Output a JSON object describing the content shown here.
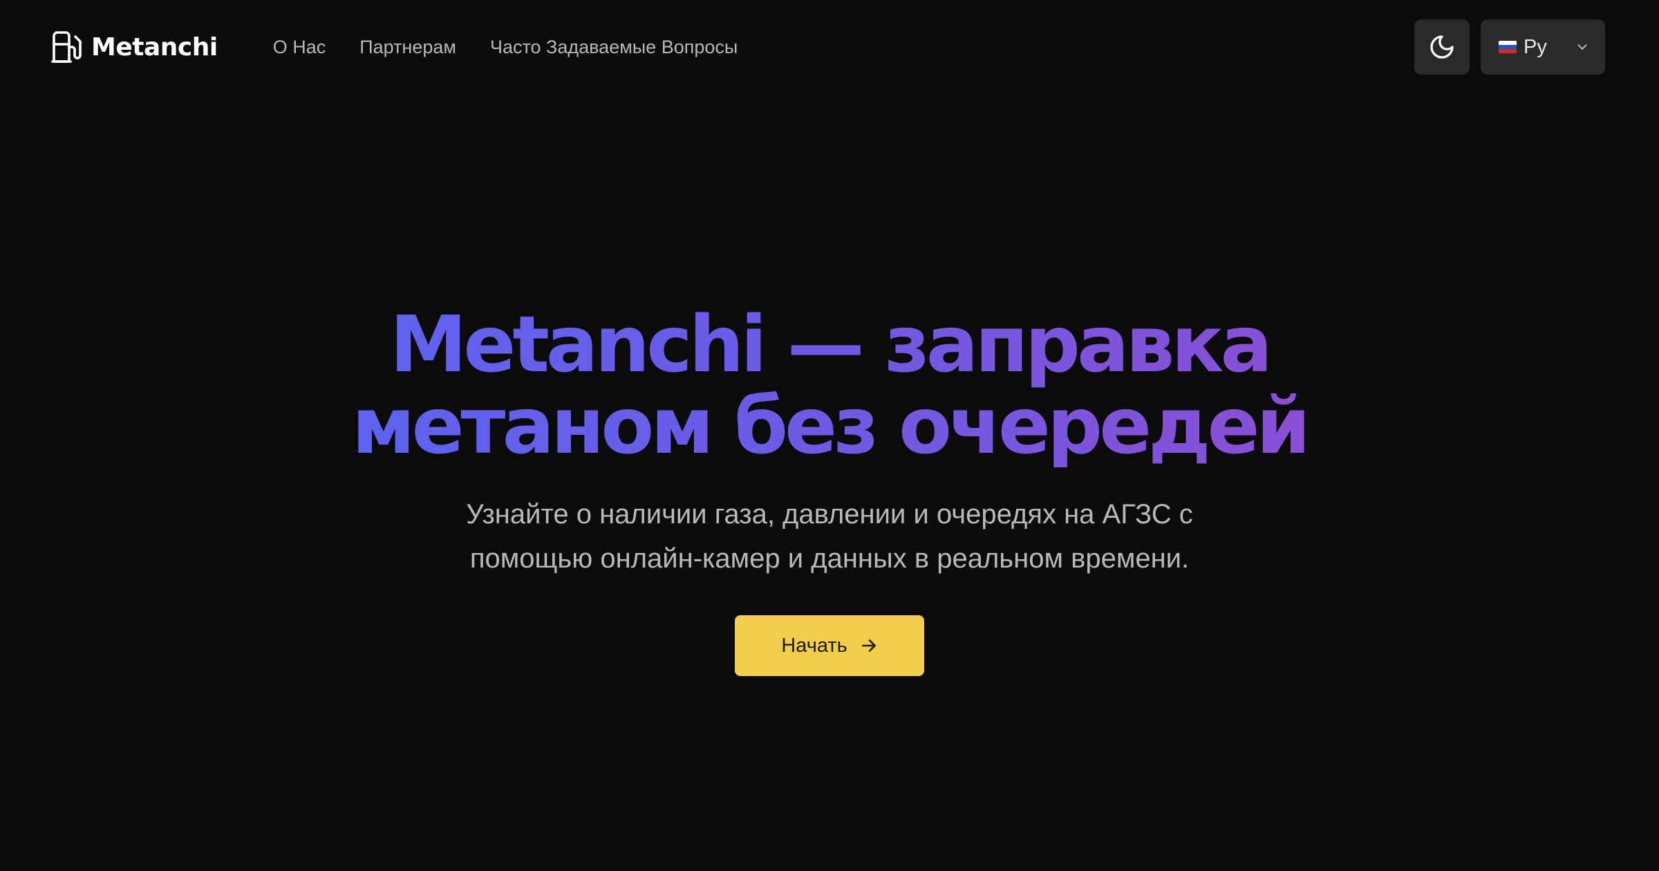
{
  "brand": {
    "name": "Metanchi",
    "icon": "fuel-pump-icon"
  },
  "nav": {
    "items": [
      {
        "label": "О Нас"
      },
      {
        "label": "Партнерам"
      },
      {
        "label": "Часто Задаваемые Вопросы"
      }
    ]
  },
  "header": {
    "theme_toggle_icon": "moon-icon",
    "language": {
      "label": "Ру",
      "flag_icon": "russia-flag-icon",
      "dropdown_icon": "chevron-down-icon"
    }
  },
  "hero": {
    "title_line1": "Metanchi — заправка",
    "title_line2": "метаном без очередей",
    "subtitle_line1": "Узнайте о наличии газа, давлении и очередях на АГЗС с",
    "subtitle_line2": "помощью онлайн-камер и данных в реальном времени.",
    "cta_label": "Начать",
    "cta_icon": "arrow-right-icon"
  },
  "colors": {
    "background": "#0b0b0b",
    "title_gradient_start": "#5e63f0",
    "title_gradient_end": "#8a4fd6",
    "cta_background": "#f3cd4b",
    "control_background": "#2a2a2a"
  }
}
